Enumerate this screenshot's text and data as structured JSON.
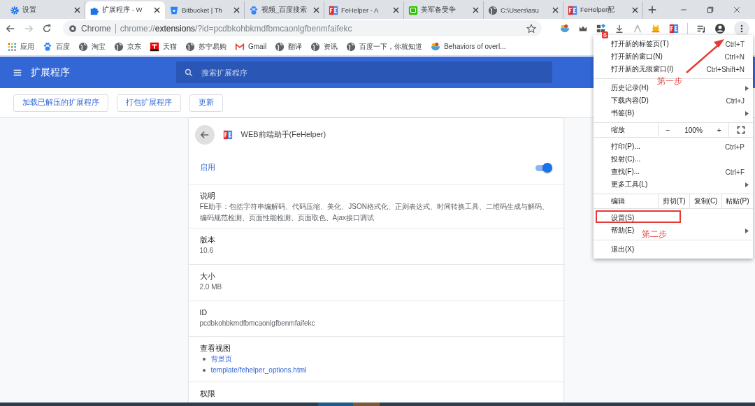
{
  "tabs": [
    {
      "title": "设置",
      "kind": "gear",
      "selected": false
    },
    {
      "title": "扩展程序 - W",
      "kind": "puzzle",
      "selected": true
    },
    {
      "title": "Bitbucket | Th",
      "kind": "bucket",
      "selected": false
    },
    {
      "title": "视频_百度搜索",
      "kind": "paw",
      "selected": false
    },
    {
      "title": "FeHelper - A",
      "kind": "fe",
      "selected": false
    },
    {
      "title": "美军备受争",
      "kind": "green",
      "selected": false
    },
    {
      "title": "C:\\Users\\asu",
      "kind": "globe",
      "selected": false
    },
    {
      "title": "FeHelper配",
      "kind": "fe",
      "selected": false
    }
  ],
  "nav": {
    "forward_disabled": true
  },
  "address": {
    "scheme_label": "Chrome",
    "url": "chrome://**extensions**/?id=pcdbkohbkmdfbmcaonlgfbenmfaifekc"
  },
  "extensions": [
    {
      "kind": "bowl"
    },
    {
      "kind": "crown"
    },
    {
      "kind": "blocks",
      "badge": "6"
    },
    {
      "kind": "download"
    },
    {
      "kind": "peak"
    },
    {
      "kind": "cat"
    },
    {
      "kind": "fe"
    }
  ],
  "bookmarks": [
    {
      "label": "应用",
      "kind": "apps"
    },
    {
      "label": "百度",
      "kind": "paw"
    },
    {
      "label": "淘宝",
      "kind": "globe"
    },
    {
      "label": "京东",
      "kind": "globe"
    },
    {
      "label": "天猫",
      "kind": "tmall"
    },
    {
      "label": "苏宁易购",
      "kind": "globe"
    },
    {
      "label": "Gmail",
      "kind": "gmail"
    },
    {
      "label": "翻译",
      "kind": "globe"
    },
    {
      "label": "资讯",
      "kind": "globe"
    },
    {
      "label": "百度一下，你就知道",
      "kind": "globe"
    },
    {
      "label": "Behaviors of overl...",
      "kind": "bowl"
    }
  ],
  "header": {
    "title": "扩展程序",
    "search_placeholder": "搜索扩展程序"
  },
  "actions": [
    "加载已解压的扩展程序",
    "打包扩展程序",
    "更新"
  ],
  "detail": {
    "name": "WEB前端助手(FeHelper)",
    "enabled_label": "启用",
    "enabled": true,
    "sections": [
      {
        "kind": "text",
        "label": "说明",
        "value": "FE助手：包括字符串编解码、代码压缩、美化、JSON格式化、正则表达式、时间转换工具、二维码生成与解码、编码规范检测、页面性能检测、页面取色、Ajax接口调试"
      },
      {
        "kind": "text",
        "label": "版本",
        "value": "10.6"
      },
      {
        "kind": "text",
        "label": "大小",
        "value": "2.0 MB"
      },
      {
        "kind": "text",
        "label": "ID",
        "value": "pcdbkohbkmdfbmcaonlgfbenmfaifekc"
      },
      {
        "kind": "links",
        "label": "查看视图",
        "links": [
          "背景页",
          "template/fehelper_options.html"
        ]
      },
      {
        "kind": "heading",
        "label": "权限"
      }
    ]
  },
  "menu": {
    "items": [
      {
        "kind": "item",
        "label": "打开新的标签页(T)",
        "shortcut": "Ctrl+T",
        "submenu": false,
        "boxed": false
      },
      {
        "kind": "item",
        "label": "打开新的窗口(N)",
        "shortcut": "Ctrl+N",
        "submenu": false,
        "boxed": false
      },
      {
        "kind": "item",
        "label": "打开新的无痕窗口(I)",
        "shortcut": "Ctrl+Shift+N",
        "submenu": false,
        "boxed": false
      },
      {
        "kind": "separator"
      },
      {
        "kind": "item",
        "label": "历史记录(H)",
        "submenu": true,
        "boxed": false
      },
      {
        "kind": "item",
        "label": "下载内容(D)",
        "shortcut": "Ctrl+J",
        "submenu": false,
        "boxed": false
      },
      {
        "kind": "item",
        "label": "书签(B)",
        "submenu": true,
        "boxed": false
      },
      {
        "kind": "zoom",
        "label": "缩放",
        "minus": "−",
        "value": "100%",
        "plus": "+"
      },
      {
        "kind": "item",
        "label": "打印(P)...",
        "shortcut": "Ctrl+P",
        "submenu": false,
        "boxed": false
      },
      {
        "kind": "item",
        "label": "投射(C)...",
        "submenu": false,
        "boxed": false
      },
      {
        "kind": "item",
        "label": "查找(F)...",
        "shortcut": "Ctrl+F",
        "submenu": false,
        "boxed": false
      },
      {
        "kind": "item",
        "label": "更多工具(L)",
        "submenu": true,
        "boxed": false
      },
      {
        "kind": "edit",
        "label": "编辑",
        "cut": "剪切(T)",
        "copy": "复制(C)",
        "paste": "粘贴(P)"
      },
      {
        "kind": "item",
        "label": "设置(S)",
        "submenu": false,
        "boxed": true
      },
      {
        "kind": "item",
        "label": "帮助(E)",
        "submenu": true,
        "boxed": false
      },
      {
        "kind": "separator"
      },
      {
        "kind": "item",
        "label": "退出(X)",
        "submenu": false,
        "boxed": false
      }
    ]
  },
  "annotations": [
    {
      "text": "第一步"
    },
    {
      "text": "第二步"
    }
  ]
}
